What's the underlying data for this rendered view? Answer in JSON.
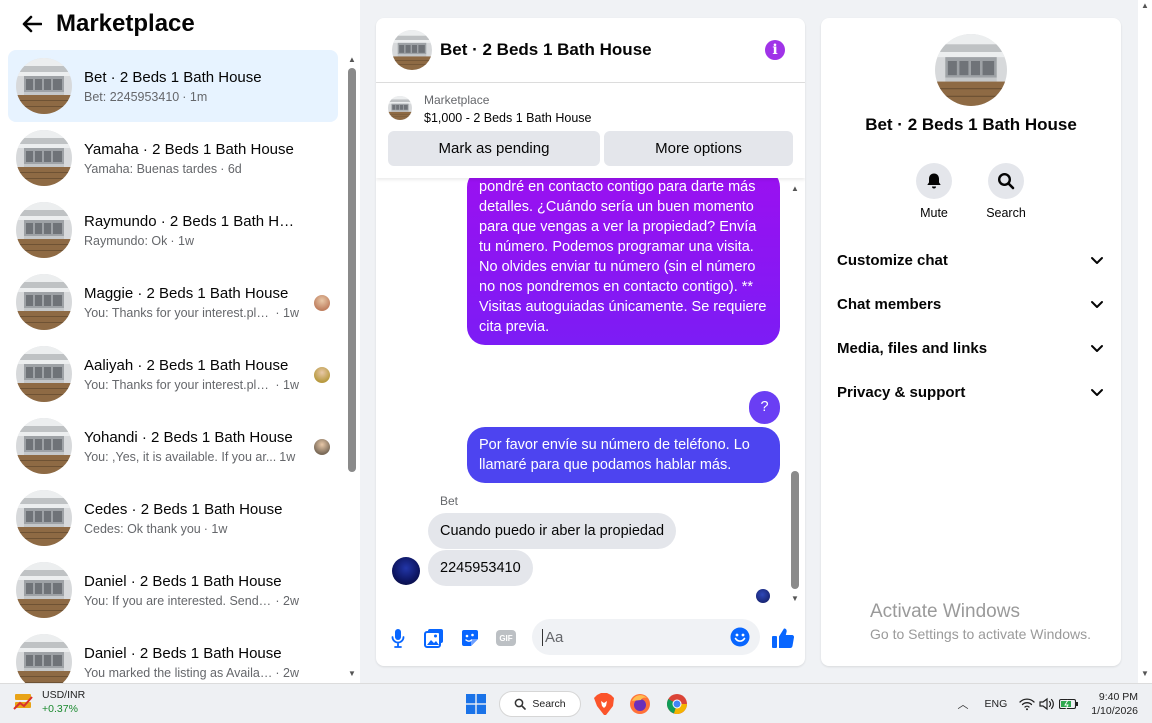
{
  "left": {
    "title": "Marketplace",
    "conversations": [
      {
        "title": "Bet · 2 Beds 1 Bath House",
        "snippet": "Bet: 2245953410",
        "time": "· 1m"
      },
      {
        "title": "Yamaha · 2 Beds 1 Bath House",
        "snippet": "Yamaha: Buenas tardes",
        "time": "· 6d"
      },
      {
        "title": "Raymundo · 2 Beds 1 Bath House",
        "snippet": "Raymundo: Ok",
        "time": "· 1w"
      },
      {
        "title": "Maggie · 2 Beds 1 Bath House",
        "snippet": "You: Thanks for your interest.ple...",
        "time": "· 1w"
      },
      {
        "title": "Aaliyah · 2 Beds 1 Bath House",
        "snippet": "You: Thanks for your interest.ple...",
        "time": "· 1w"
      },
      {
        "title": "Yohandi · 2 Beds 1 Bath House",
        "snippet": "You: ,Yes, it is available. If you ar...",
        "time": "1w"
      },
      {
        "title": "Cedes · 2 Beds 1 Bath House",
        "snippet": "Cedes: Ok thank you",
        "time": "· 1w"
      },
      {
        "title": "Daniel · 2 Beds 1 Bath House",
        "snippet": "You: If you are interested. Send yo...",
        "time": "· 2w"
      },
      {
        "title": "Daniel · 2 Beds 1 Bath House",
        "snippet": "You marked the listing as Available.",
        "time": "· 2w"
      }
    ]
  },
  "chat": {
    "title": "Bet · 2 Beds 1 Bath House",
    "listing_source": "Marketplace",
    "listing_price": "$1,000 - 2 Beds 1 Bath House",
    "mark_pending_label": "Mark as pending",
    "more_options_label": "More options",
    "messages": {
      "out_long": "pondré en contacto contigo para darte más detalles. ¿Cuándo sería un buen momento para que vengas a ver la propiedad? Envía tu número. Podemos programar una visita. No olvides enviar tu número (sin el número no nos pondremos en contacto contigo). ** Visitas autoguiadas únicamente. Se requiere cita previa.",
      "out_q": "?",
      "out_phone_req": "Por favor envíe su número de teléfono. Lo llamaré para que podamos hablar más.",
      "sender_name": "Bet",
      "in_1": "Cuando puedo ir aber la propiedad",
      "in_2": "2245953410"
    },
    "input_placeholder": "Aa",
    "gif_label": "GIF"
  },
  "details": {
    "title": "Bet · 2 Beds 1 Bath House",
    "mute_label": "Mute",
    "search_label": "Search",
    "sections": [
      "Customize chat",
      "Chat members",
      "Media, files and links",
      "Privacy & support"
    ]
  },
  "watermark": {
    "title": "Activate Windows",
    "subtitle": "Go to Settings to activate Windows."
  },
  "taskbar": {
    "widget_title": "USD/INR",
    "widget_change": "+0.37%",
    "search_label": "Search",
    "lang": "ENG",
    "time": "9:40 PM",
    "date": "1/10/2026"
  },
  "colors": {
    "accent": "#0866ff",
    "bubble_purple": "#9b10f0",
    "bubble_blue": "#4d44f0",
    "info_purple": "#a033e8"
  }
}
